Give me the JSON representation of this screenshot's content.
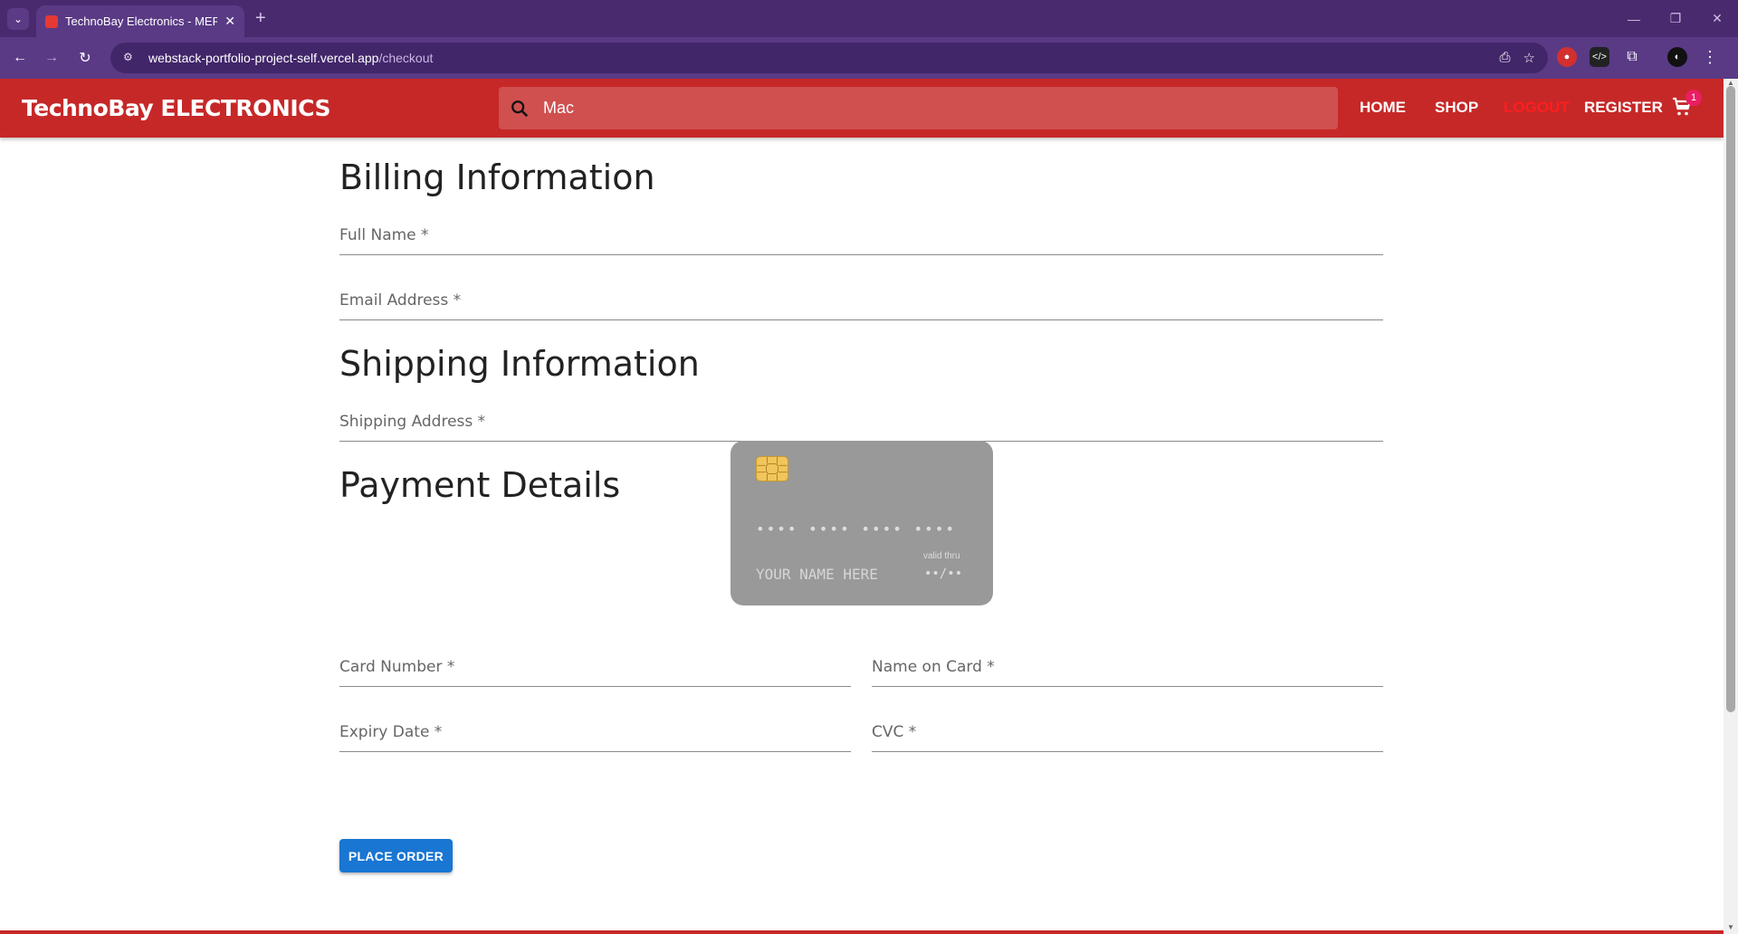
{
  "browser": {
    "tab_title": "TechnoBay Electronics - MERN I",
    "url_host": "webstack-portfolio-project-self.vercel.app",
    "url_path": "/checkout"
  },
  "header": {
    "logo": "TechnoBay ELECTRONICS",
    "search_value": "Mac",
    "nav": {
      "home": "HOME",
      "shop": "SHOP",
      "logout": "LOGOUT",
      "register": "REGISTER"
    },
    "cart_count": "1"
  },
  "billing": {
    "title": "Billing Information",
    "full_name_label": "Full Name *",
    "email_label": "Email Address *"
  },
  "shipping": {
    "title": "Shipping Information",
    "address_label": "Shipping Address *"
  },
  "payment": {
    "title": "Payment Details",
    "card_preview": {
      "number": "•••• •••• •••• ••••",
      "name": "YOUR NAME HERE",
      "valid_label": "valid thru",
      "expiry": "••/••"
    },
    "card_number_label": "Card Number *",
    "name_on_card_label": "Name on Card *",
    "expiry_label": "Expiry Date *",
    "cvc_label": "CVC *",
    "submit": "PLACE ORDER"
  },
  "colors": {
    "header": "#c62828",
    "button": "#1976d2",
    "logout": "#ff1e1e",
    "badge": "#e91e63"
  }
}
